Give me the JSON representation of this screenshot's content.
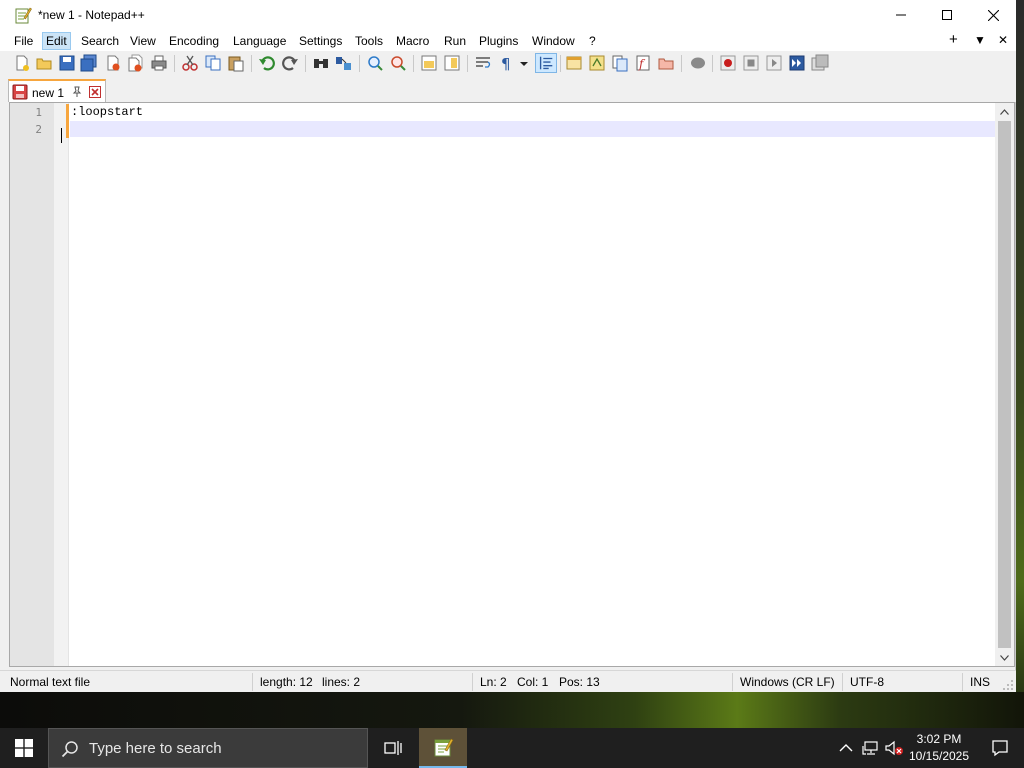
{
  "window": {
    "title": "*new 1 - Notepad++"
  },
  "menu": {
    "items": [
      "File",
      "Edit",
      "Search",
      "View",
      "Encoding",
      "Language",
      "Settings",
      "Tools",
      "Macro",
      "Run",
      "Plugins",
      "Window",
      "?"
    ],
    "active": "Edit",
    "right": {
      "plus": "+",
      "dropdown": "▼",
      "close": "✕"
    }
  },
  "toolbar": {
    "icons": [
      "new-file-icon",
      "open-file-icon",
      "save-icon",
      "save-all-icon",
      "close-icon",
      "close-all-icon",
      "print-icon",
      "cut-icon",
      "copy-icon",
      "paste-icon",
      "undo-icon",
      "redo-icon",
      "find-icon",
      "replace-icon",
      "zoom-in-icon",
      "zoom-out-icon",
      "sync-vertical-icon",
      "sync-horizontal-icon",
      "word-wrap-icon",
      "show-all-chars-icon",
      "indent-guide-icon",
      "doc-map-icon",
      "function-list-icon",
      "folder-workspace-icon",
      "document-list-icon",
      "monitoring-icon",
      "record-macro-icon",
      "stop-macro-icon",
      "play-macro-icon",
      "run-macro-multiple-icon",
      "save-macro-icon"
    ],
    "pressed": "indent-guide-icon"
  },
  "tab": {
    "label": "new 1"
  },
  "editor": {
    "lines": [
      {
        "number": "1",
        "text": ":loopstart"
      },
      {
        "number": "2",
        "text": ""
      }
    ],
    "current_line": 2
  },
  "statusbar": {
    "doc_type": "Normal text file",
    "length": "length: 12",
    "lines": "lines: 2",
    "ln": "Ln: 2",
    "col": "Col: 1",
    "pos": "Pos: 13",
    "eol": "Windows (CR LF)",
    "encoding": "UTF-8",
    "mode": "INS"
  },
  "taskbar": {
    "search_placeholder": "Type here to search",
    "time": "3:02 PM",
    "date": "10/15/2025"
  },
  "colors": {
    "accent_orange": "#f7a63e",
    "current_line": "#e8e8ff",
    "taskbar": "#1f1f1f"
  }
}
